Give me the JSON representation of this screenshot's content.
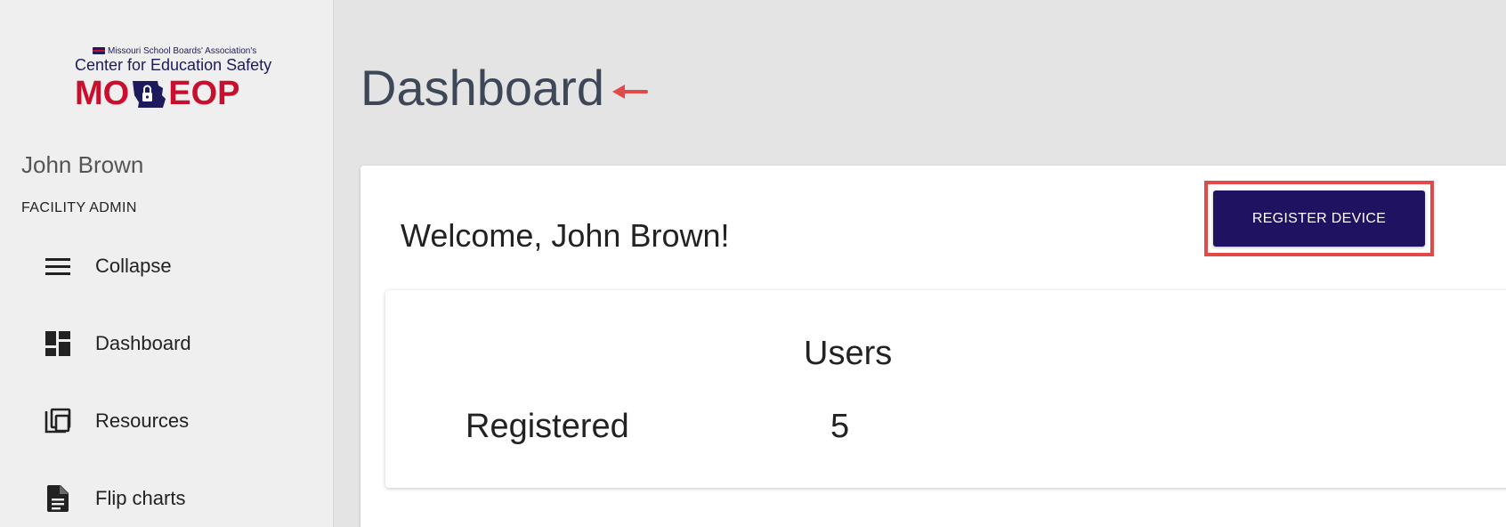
{
  "logo": {
    "org_line": "Missouri School Boards' Association's",
    "center_line": "Center for Education Safety",
    "brand_left": "MO",
    "brand_right": "EOP"
  },
  "user": {
    "name": "John Brown",
    "role": "FACILITY ADMIN"
  },
  "sidebar": {
    "items": [
      {
        "label": "Collapse",
        "icon": "menu-icon"
      },
      {
        "label": "Dashboard",
        "icon": "dashboard-icon"
      },
      {
        "label": "Resources",
        "icon": "library-icon"
      },
      {
        "label": "Flip charts",
        "icon": "document-icon"
      }
    ]
  },
  "main": {
    "title": "Dashboard",
    "welcome": "Welcome, John Brown!",
    "register_button": "REGISTER DEVICE",
    "stats": {
      "column_header": "Users",
      "row_label": "Registered",
      "value": "5"
    }
  },
  "colors": {
    "accent": "#1f1260",
    "highlight": "#e24a4a",
    "brand_red": "#c8102e",
    "brand_navy": "#1d1b5e"
  }
}
